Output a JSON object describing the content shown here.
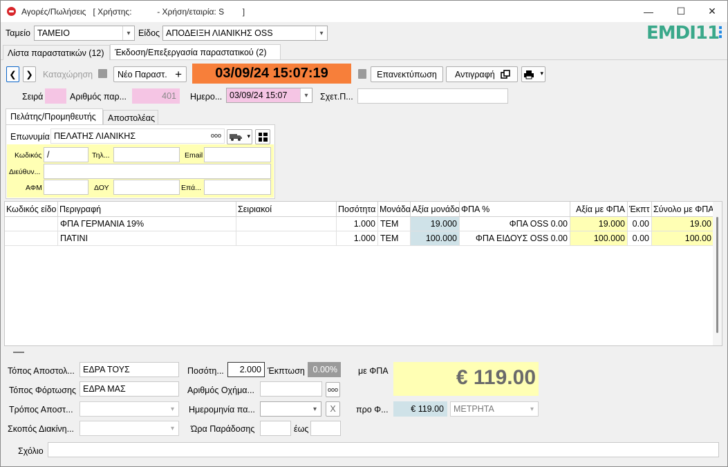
{
  "window": {
    "title": "Αγορές/Πωλήσεις   [ Χρήστης:           - Χρήση/εταιρία: S        ]",
    "minimize": "—",
    "maximize": "☐",
    "close": "✕"
  },
  "header": {
    "tameio_label": "Ταμείο",
    "tameio_value": "ΤΑΜΕΙΟ",
    "eidos_label": "Είδος",
    "eidos_value": "ΑΠΟΔΕΙΞΗ ΛΙΑΝΙΚΗΣ OSS",
    "logo_text": "EMDI11",
    "menu": "⋮"
  },
  "tabs": [
    {
      "label": "Λίστα παραστατικών (12)"
    },
    {
      "label": "Έκδοση/Επεξεργασία παραστατικού (2)"
    }
  ],
  "toolbar": {
    "prev": "❮",
    "next": "❯",
    "register_label": "Καταχώρηση",
    "new_label": "Νέο Παραστ.",
    "datetime": "03/09/24 15:07:19",
    "reprint_label": "Επανεκτύπωση",
    "copy_label": "Αντιγραφή"
  },
  "doc": {
    "seira_label": "Σειρά",
    "seira_value": "",
    "arithmos_label": "Αριθμός παρ...",
    "arithmos_value": "401",
    "hmero_label": "Ημερο...",
    "hmero_value": "03/09/24 15:07",
    "sxet_label": "Σχετ.Π...",
    "sxet_value": ""
  },
  "customer_tabs": [
    {
      "label": "Πελάτης/Προμηθευτής"
    },
    {
      "label": "Αποστολέας"
    }
  ],
  "customer": {
    "eponymia_label": "Επωνυμία",
    "eponymia_value": "ΠΕΛΑΤΗΣ ΛΙΑΝΙΚΗΣ",
    "kodikos_label": "Κωδικός",
    "kodikos_value": "/",
    "til_label": "Τηλ...",
    "til_value": "",
    "email_label": "Email",
    "email_value": "",
    "dieuth_label": "Διεύθυν...",
    "dieuth_value": "",
    "afm_label": "ΑΦΜ",
    "afm_value": "",
    "doy_label": "ΔΟΥ",
    "doy_value": "",
    "epag_label": "Επά...",
    "epag_value": "",
    "more": "ooo"
  },
  "grid": {
    "columns": [
      "Κωδικός είδο",
      "Περιγραφή",
      "Σειριακοί",
      "Ποσότητα",
      "Μονάδα",
      "Αξία μονάδο",
      "ΦΠΑ %",
      "Αξία με ΦΠΑ",
      "Έκπτ",
      "Σύνολο με ΦΠΑ"
    ],
    "rows": [
      {
        "code": "",
        "desc": "ΦΠΑ ΓΕΡΜΑΝΙΑ 19%",
        "serial": "",
        "qty": "1.000",
        "unit": "ΤΕΜ",
        "unit_value": "19.000",
        "vat": "ΦΠΑ OSS 0.00",
        "value_vat": "19.000",
        "disc": "0.00",
        "total": "19.00"
      },
      {
        "code": "",
        "desc": "ΠΑΤΙΝΙ",
        "serial": "",
        "qty": "1.000",
        "unit": "ΤΕΜ",
        "unit_value": "100.000",
        "vat": "ΦΠΑ ΕΙΔΟΥΣ OSS 0.00",
        "value_vat": "100.000",
        "disc": "0.00",
        "total": "100.00"
      }
    ]
  },
  "footer": {
    "topos_apostolis_label": "Τόπος Αποστολ...",
    "topos_apostolis_value": "ΕΔΡΑ ΤΟΥΣ",
    "topos_fortosis_label": "Τόπος Φόρτωσης",
    "topos_fortosis_value": "ΕΔΡΑ ΜΑΣ",
    "tropos_label": "Τρόπος Αποστ...",
    "tropos_value": "",
    "skopos_label": "Σκοπός Διακίνη...",
    "skopos_value": "",
    "posotita_label": "Ποσότη...",
    "posotita_value": "2.000",
    "ekptosi_label": "Έκπτωση",
    "ekptosi_value": "0.00%",
    "oxima_label": "Αριθμός Οχήμα...",
    "oxima_value": "",
    "oxima_more": "ooo",
    "hmerominia_label": "Ημερομηνία πα...",
    "hmerominia_value": "",
    "clear_x": "X",
    "ora_label": "Ώρα Παράδοσης",
    "ora_value": "",
    "eos_label": "έως",
    "eos_value": "",
    "me_fpa_label": "με ΦΠΑ",
    "total_big": "€ 119.00",
    "pro_label": "προ Φ...",
    "pro_value": "€ 119.00",
    "payment_value": "ΜΕΤΡΗΤΑ",
    "sxolio_label": "Σχόλιο",
    "sxolio_value": ""
  }
}
